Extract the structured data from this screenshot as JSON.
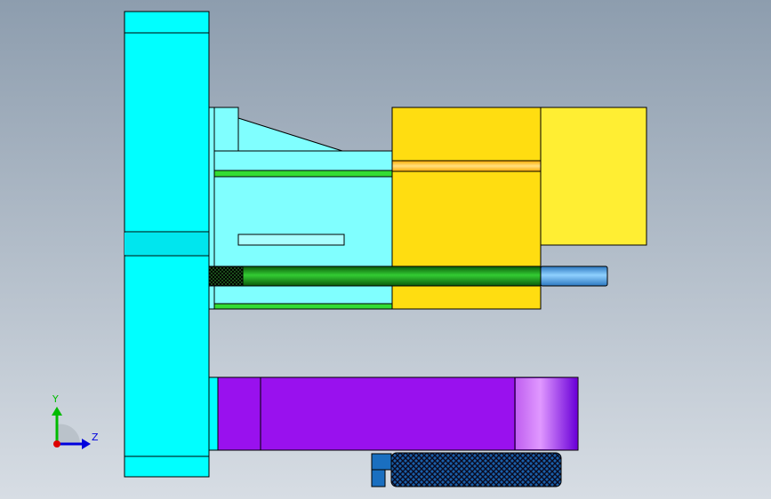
{
  "viewport": {
    "background_top": "#8d9dae",
    "background_bottom": "#d7dde4"
  },
  "model": {
    "parts": [
      {
        "name": "base-plate",
        "color": "#00ffff"
      },
      {
        "name": "slide-block",
        "color": "#80ffff"
      },
      {
        "name": "guide-rail",
        "color": "#33dd33"
      },
      {
        "name": "cylinder-body",
        "color": "#ffdd11"
      },
      {
        "name": "end-cap",
        "color": "#ffee33"
      },
      {
        "name": "piston-rod",
        "color": "#119911"
      },
      {
        "name": "rod-tip",
        "color": "#55aaee"
      },
      {
        "name": "clamp-bar",
        "color": "#9911ee"
      },
      {
        "name": "knurled-nut",
        "color": "#1177cc"
      }
    ]
  },
  "triad": {
    "y_label": "Y",
    "z_label": "Z",
    "y_color": "#00bb00",
    "z_color": "#0000dd",
    "origin_color": "#dd0000"
  }
}
